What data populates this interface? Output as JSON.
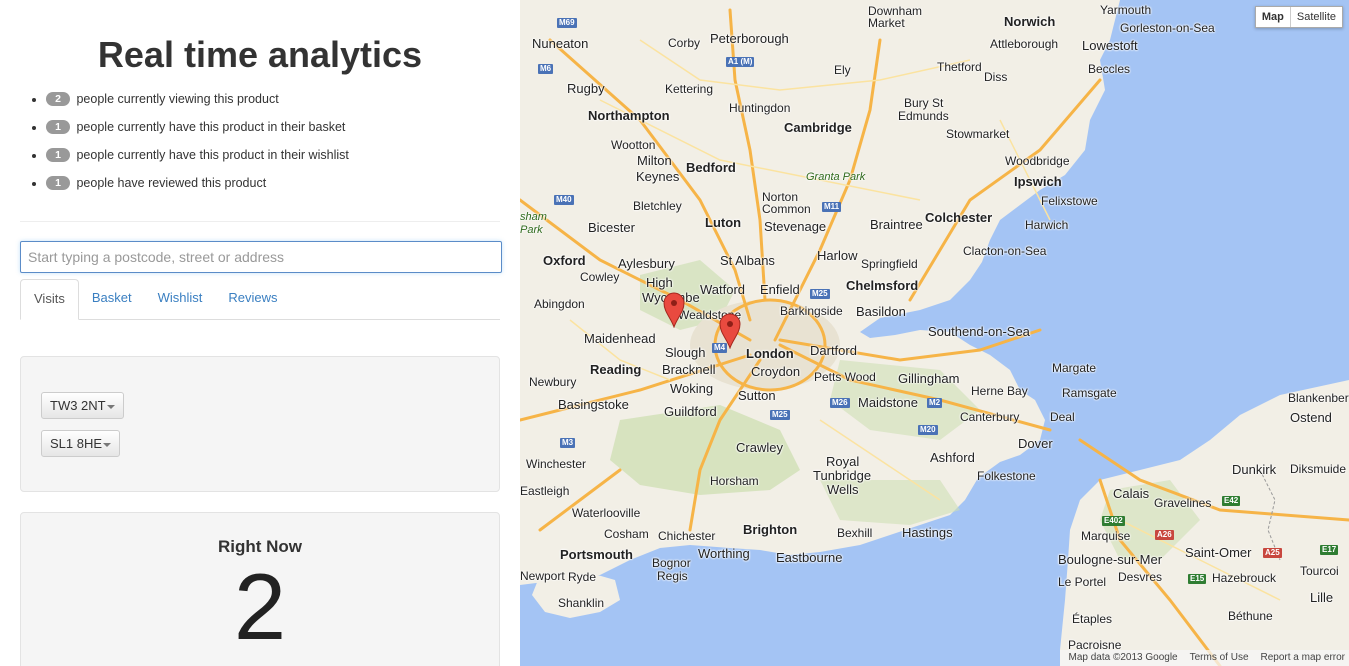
{
  "title": "Real time analytics",
  "stats": [
    {
      "count": "2",
      "text": "people currently viewing this product"
    },
    {
      "count": "1",
      "text": "people currently have this product in their basket"
    },
    {
      "count": "1",
      "text": "people currently have this product in their wishlist"
    },
    {
      "count": "1",
      "text": "people have reviewed this product"
    }
  ],
  "search": {
    "placeholder": "Start typing a postcode, street or address"
  },
  "tabs": [
    {
      "label": "Visits",
      "active": true
    },
    {
      "label": "Basket"
    },
    {
      "label": "Wishlist"
    },
    {
      "label": "Reviews"
    }
  ],
  "postcodes": [
    "TW3 2NT",
    "SL1 8HE"
  ],
  "right_now": {
    "label": "Right Now",
    "value": "2"
  },
  "map": {
    "type_buttons": {
      "map": "Map",
      "satellite": "Satellite"
    },
    "attribution": {
      "data": "Map data ©2013 Google",
      "terms": "Terms of Use",
      "report": "Report a map error"
    },
    "places": {
      "nuneaton": "Nuneaton",
      "corby": "Corby",
      "peterborough": "Peterborough",
      "downham": "Downham",
      "market": "Market",
      "norwich": "Norwich",
      "yarmouth": "Yarmouth",
      "gorleston": "Gorleston-on-Sea",
      "attleborough": "Attleborough",
      "lowestoft": "Lowestoft",
      "rugby": "Rugby",
      "kettering": "Kettering",
      "ely": "Ely",
      "thetford": "Thetford",
      "diss": "Diss",
      "beccles": "Beccles",
      "huntingdon": "Huntingdon",
      "northampton": "Northampton",
      "bury": "Bury St",
      "edmunds": "Edmunds",
      "cambridge": "Cambridge",
      "stowmarket": "Stowmarket",
      "wootton": "Wootton",
      "milton": "Milton",
      "keynes": "Keynes",
      "bedford": "Bedford",
      "woodbridge": "Woodbridge",
      "granta": "Granta Park",
      "ipswich": "Ipswich",
      "bletchley": "Bletchley",
      "felixstowe": "Felixstowe",
      "norton": "Norton",
      "common": "Common",
      "luton": "Luton",
      "stevenage": "Stevenage",
      "braintree": "Braintree",
      "colchester": "Colchester",
      "harwich": "Harwich",
      "bicester": "Bicester",
      "aylesbury": "Aylesbury",
      "stalbans": "St Albans",
      "harlow": "Harlow",
      "springfield": "Springfield",
      "clacton": "Clacton-on-Sea",
      "oxford": "Oxford",
      "cowley": "Cowley",
      "high": "High",
      "wycombe": "Wycombe",
      "watford": "Watford",
      "enfield": "Enfield",
      "chelmsford": "Chelmsford",
      "abingdon": "Abingdon",
      "wealdstone": "Wealdstone",
      "barkingside": "Barkingside",
      "basildon": "Basildon",
      "maidenhead": "Maidenhead",
      "slough": "Slough",
      "london": "London",
      "dartford": "Dartford",
      "southend": "Southend-on-Sea",
      "reading": "Reading",
      "bracknell": "Bracknell",
      "croydon": "Croydon",
      "pettswood": "Petts Wood",
      "gillingham": "Gillingham",
      "margate": "Margate",
      "newbury": "Newbury",
      "woking": "Woking",
      "sutton": "Sutton",
      "hernebay": "Herne Bay",
      "ramsgate": "Ramsgate",
      "basingstoke": "Basingstoke",
      "guildford": "Guildford",
      "maidstone": "Maidstone",
      "canterbury": "Canterbury",
      "deal": "Deal",
      "blankenberge": "Blankenber",
      "ostend": "Ostend",
      "crawley": "Crawley",
      "dover": "Dover",
      "winchester": "Winchester",
      "royal": "Royal",
      "tunbridge": "Tunbridge",
      "wells": "Wells",
      "ashford": "Ashford",
      "dunkirk": "Dunkirk",
      "diksmuide": "Diksmuide",
      "horsham": "Horsham",
      "folkestone": "Folkestone",
      "eastleigh": "Eastleigh",
      "calais": "Calais",
      "gravelines": "Gravelines",
      "waterlooville": "Waterlooville",
      "brighton": "Brighton",
      "hastings": "Hastings",
      "chichester": "Chichester",
      "cosham": "Cosham",
      "bexhill": "Bexhill",
      "marquise": "Marquise",
      "portsmouth": "Portsmouth",
      "worthing": "Worthing",
      "eastbourne": "Eastbourne",
      "saintomer": "Saint-Omer",
      "boulogne": "Boulogne-sur-Mer",
      "bognor": "Bognor",
      "regis": "Regis",
      "newport": "Newport",
      "ryde": "Ryde",
      "leportel": "Le Portel",
      "desvres": "Desvres",
      "hazebrouck": "Hazebrouck",
      "tourcoing": "Tourcoi",
      "shanklin": "Shanklin",
      "lille": "Lille",
      "etaples": "Étaples",
      "bethune": "Béthune",
      "pacroisne": "Pacroisne"
    },
    "roads": {
      "m69": "M69",
      "m6": "M6",
      "a1m": "A1 (M)",
      "m40": "M40",
      "m11": "M11",
      "m25": "M25",
      "m4": "M4",
      "m26": "M26",
      "m2": "M2",
      "m25s": "M25",
      "m20": "M20",
      "m3": "M3",
      "a26": "A26",
      "e402": "E402",
      "e42": "E42",
      "e15": "E15",
      "a25": "A25",
      "e17": "E17"
    },
    "parks": {
      "sham": "sham",
      "park": "Park"
    }
  }
}
